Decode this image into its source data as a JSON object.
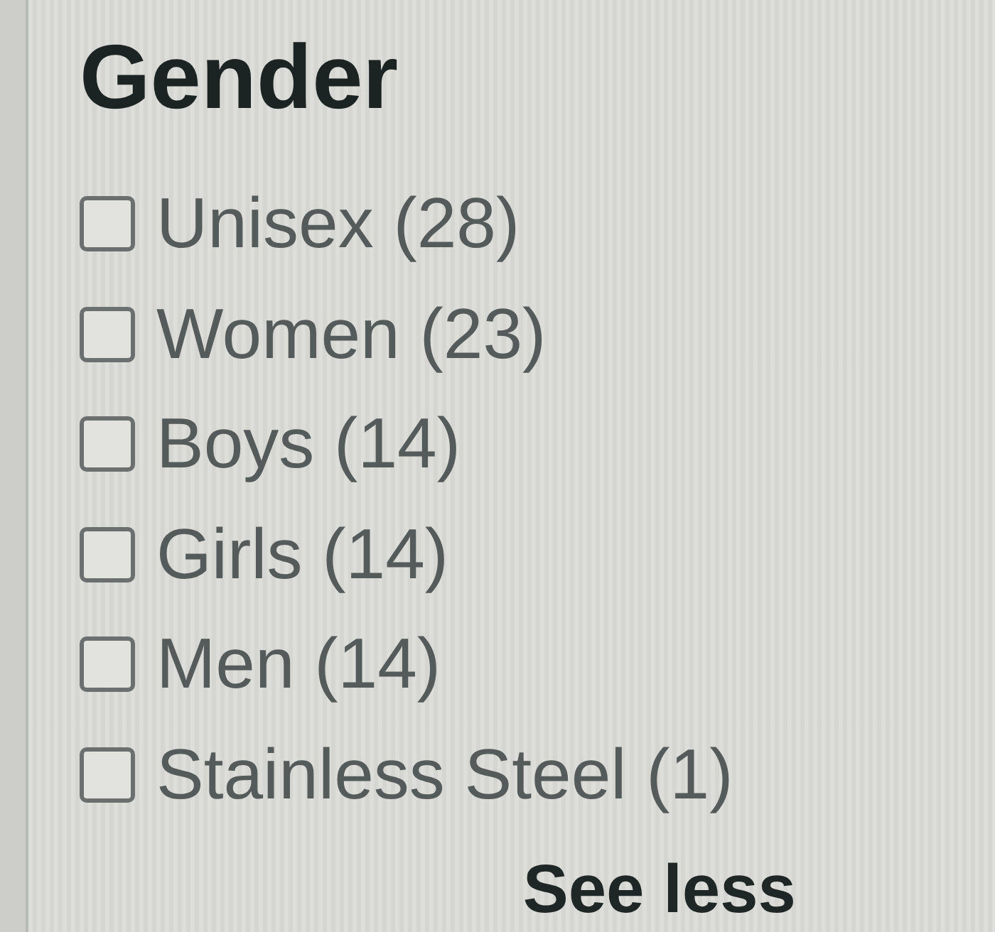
{
  "filter": {
    "title": "Gender",
    "options": [
      {
        "label": "Unisex (28)",
        "checked": false
      },
      {
        "label": "Women (23)",
        "checked": false
      },
      {
        "label": "Boys (14)",
        "checked": false
      },
      {
        "label": "Girls (14)",
        "checked": false
      },
      {
        "label": "Men (14)",
        "checked": false
      },
      {
        "label": "Stainless Steel (1)",
        "checked": false
      }
    ],
    "toggle_link": "See less"
  }
}
